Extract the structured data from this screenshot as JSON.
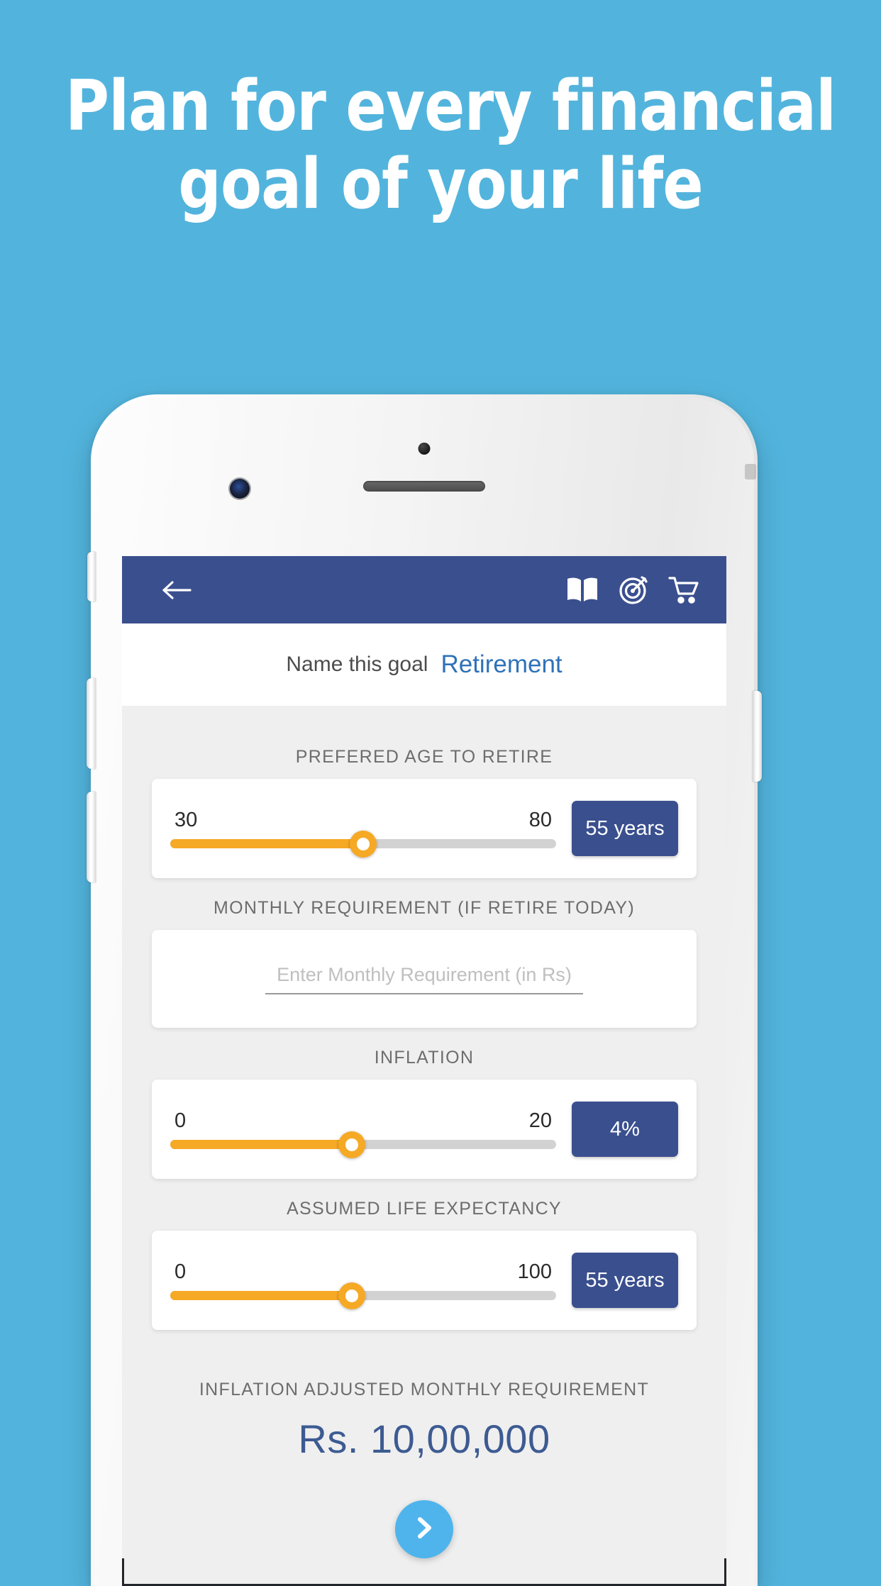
{
  "page": {
    "background_color": "#52b4dd",
    "headline_lines": [
      "Plan for every financial",
      "goal of your life"
    ]
  },
  "phone": {
    "frame_color": "#f2f2f2",
    "buttons": [
      "mute-switch",
      "volume-up",
      "volume-down",
      "power"
    ],
    "sensors": [
      "proximity-sensor",
      "earpiece-speaker",
      "front-camera"
    ]
  },
  "app": {
    "appbar": {
      "background_color": "#3a4f8e",
      "back_icon": "arrow-left-icon",
      "actions": [
        {
          "icon": "book-icon",
          "name": "book"
        },
        {
          "icon": "target-icon",
          "name": "goals"
        },
        {
          "icon": "cart-icon",
          "name": "cart"
        }
      ]
    },
    "goal_row": {
      "label": "Name this goal",
      "value": "Retirement",
      "value_color": "#2f72b8"
    },
    "sections": [
      {
        "id": "retire-age",
        "title": "PREFERED AGE TO RETIRE",
        "type": "slider",
        "min_label": "30",
        "max_label": "80",
        "min": 30,
        "max": 80,
        "value": 55,
        "percent": 50,
        "badge": "55 years"
      },
      {
        "id": "monthly-requirement",
        "title": "MONTHLY REQUIREMENT (IF RETIRE TODAY)",
        "type": "input",
        "placeholder": "Enter Monthly Requirement (in Rs)",
        "value": ""
      },
      {
        "id": "inflation",
        "title": "INFLATION",
        "type": "slider",
        "min_label": "0",
        "max_label": "20",
        "min": 0,
        "max": 20,
        "value": 4,
        "percent": 47,
        "badge": "4%"
      },
      {
        "id": "life-expectancy",
        "title": "ASSUMED LIFE EXPECTANCY",
        "type": "slider",
        "min_label": "0",
        "max_label": "100",
        "min": 0,
        "max": 100,
        "value": 55,
        "percent": 47,
        "badge": "55 years"
      }
    ],
    "result": {
      "label": "INFLATION ADJUSTED MONTHLY REQUIREMENT",
      "value": "Rs. 10,00,000",
      "value_color": "#3d5b92"
    },
    "next_button": {
      "icon": "chevron-right-icon",
      "color": "#4fb4ec"
    },
    "theme": {
      "primary": "#3a4f8e",
      "accent_orange": "#f6a925",
      "track_gray": "#d2d2d2",
      "page_bg": "#efefef"
    }
  }
}
